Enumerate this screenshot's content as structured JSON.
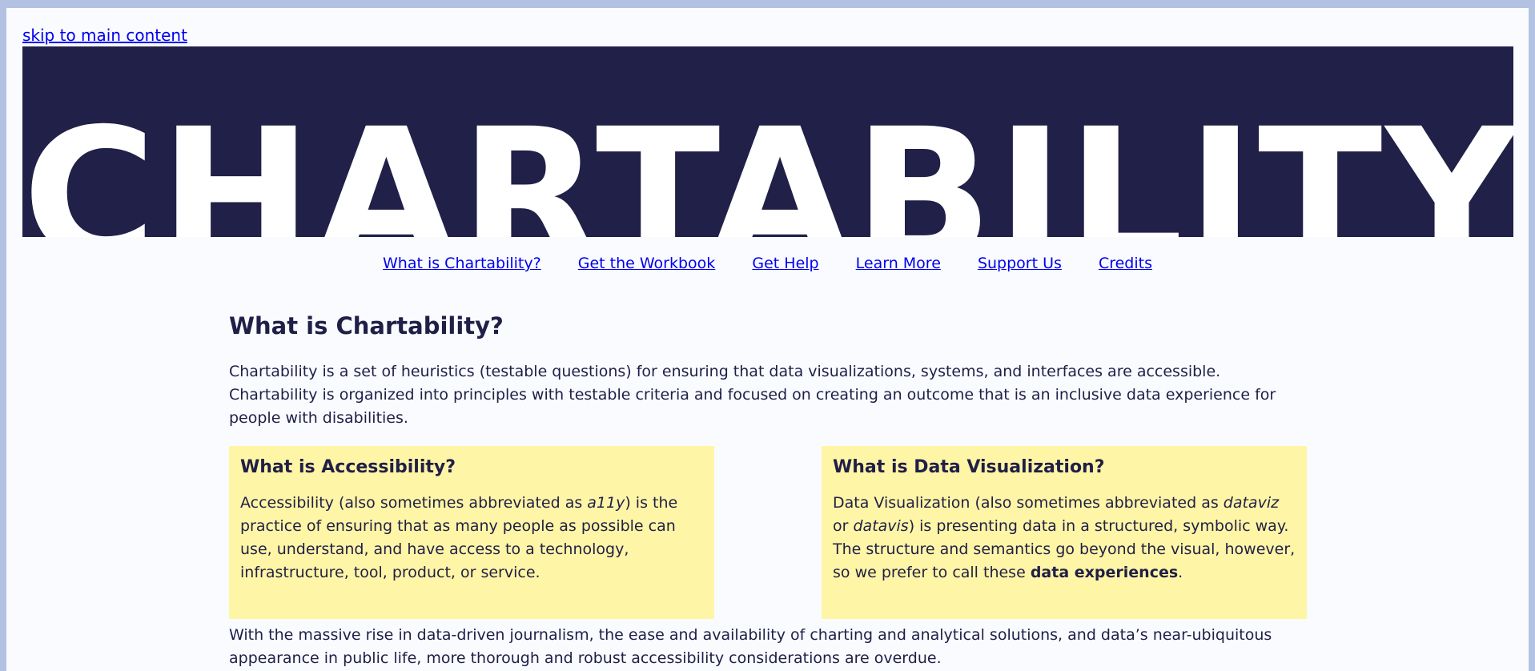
{
  "skip_link": "skip to main content",
  "banner": {
    "title": "CHARTABILITY"
  },
  "nav": {
    "items": [
      "What is Chartability?",
      "Get the Workbook",
      "Get Help",
      "Learn More",
      "Support Us",
      "Credits"
    ]
  },
  "main": {
    "heading": "What is Chartability?",
    "intro": "Chartability is a set of heuristics (testable questions) for ensuring that data visualizations, systems, and interfaces are accessible. Chartability is organized into principles with testable criteria and focused on creating an outcome that is an inclusive data experience for people with disabilities.",
    "accessibility_box": {
      "title": "What is Accessibility?",
      "text_1": "Accessibility (also sometimes abbreviated as ",
      "abbr": "a11y",
      "text_2": ") is the practice of ensuring that as many people as possible can use, understand, and have access to a technology, infrastructure, tool, product, or service."
    },
    "dataviz_box": {
      "title": "What is Data Visualization?",
      "text_1": "Data Visualization (also sometimes abbreviated as ",
      "abbr_1": "dataviz",
      "text_2": " or ",
      "abbr_2": "datavis",
      "text_3": ") is presenting data in a structured, symbolic way. The structure and semantics go beyond the visual, however, so we prefer to call these ",
      "bold": "data experiences",
      "text_4": "."
    },
    "outro": "With the massive rise in data-driven journalism, the ease and availability of charting and analytical solutions, and data’s near-ubiquitous appearance in public life, more thorough and robust accessibility considerations are overdue."
  },
  "colors": {
    "page_border": "#b3c2e2",
    "background": "#f9fbff",
    "banner": "#202048",
    "text": "#1f1f47",
    "callout": "#fff5a6",
    "link": "#0000ee"
  }
}
